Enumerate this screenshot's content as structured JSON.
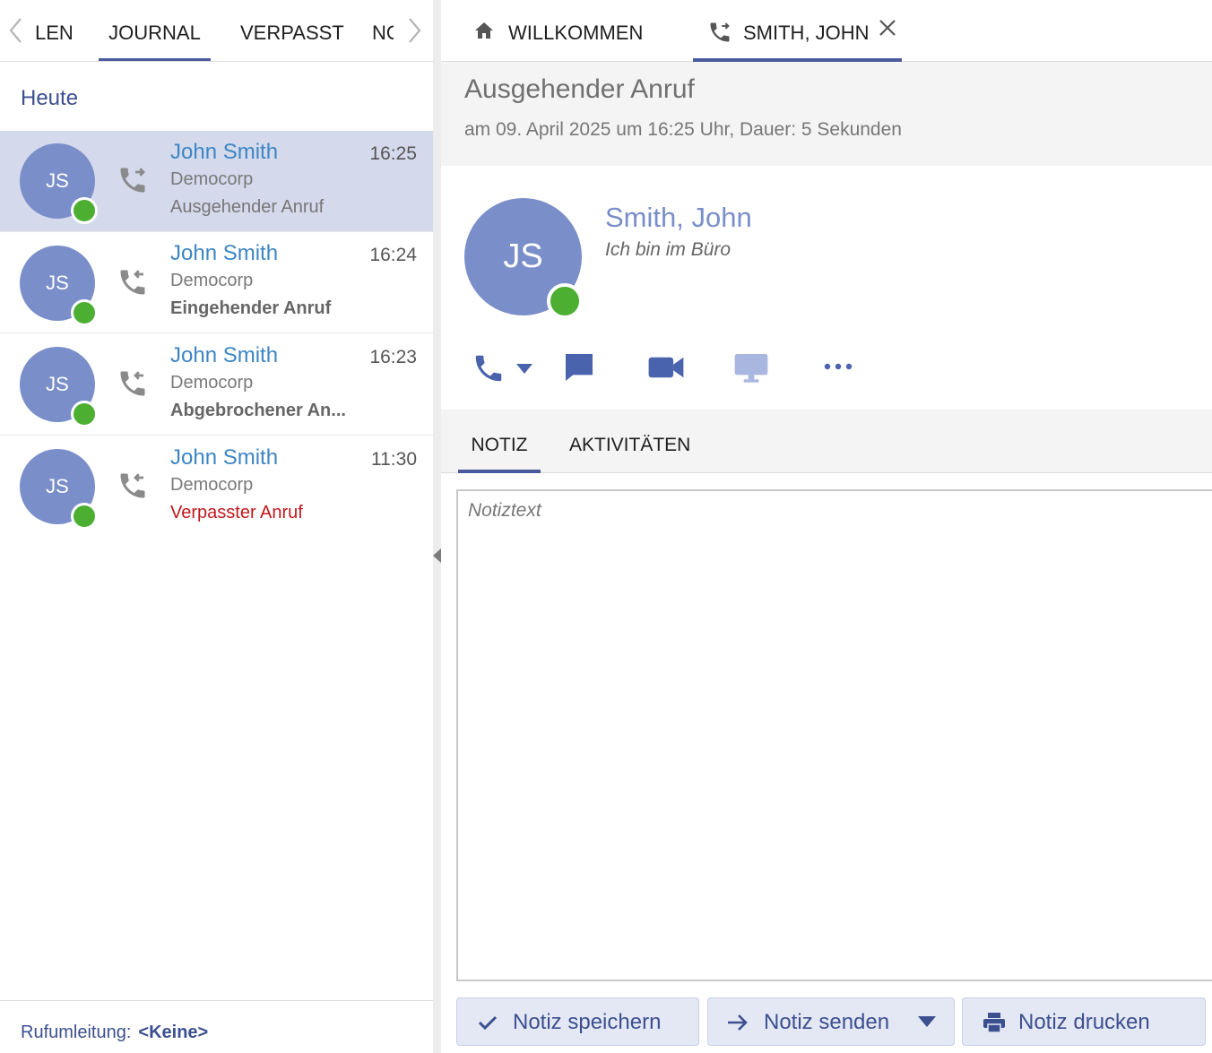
{
  "left_panel": {
    "tabs": [
      {
        "label": "LEN"
      },
      {
        "label": "JOURNAL"
      },
      {
        "label": "VERPASST"
      },
      {
        "label": "NOTIZEN"
      }
    ],
    "section_heading": "Heute",
    "calls": [
      {
        "initials": "JS",
        "name": "John Smith",
        "time": "16:25",
        "company": "Democorp",
        "status": "Ausgehender Anruf",
        "direction": "outgoing",
        "selected": true
      },
      {
        "initials": "JS",
        "name": "John Smith",
        "time": "16:24",
        "company": "Democorp",
        "status": "Eingehender Anruf",
        "direction": "incoming"
      },
      {
        "initials": "JS",
        "name": "John Smith",
        "time": "16:23",
        "company": "Democorp",
        "status": "Abgebrochener An...",
        "direction": "incoming"
      },
      {
        "initials": "JS",
        "name": "John Smith",
        "time": "11:30",
        "company": "Democorp",
        "status": "Verpasster Anruf",
        "direction": "incoming"
      }
    ],
    "footer": {
      "label": "Rufumleitung:",
      "value": "<Keine>"
    }
  },
  "right_panel": {
    "tabs": [
      {
        "label": "WILLKOMMEN",
        "icon": "home-icon"
      },
      {
        "label": "SMITH, JOHN",
        "icon": "phone-outgoing-icon"
      }
    ],
    "call_title": "Ausgehender Anruf",
    "call_details": "am 09. April 2025 um 16:25 Uhr, Dauer: 5 Sekunden",
    "contact": {
      "initials": "JS",
      "name": "Smith, John",
      "status": "Ich bin im Büro"
    },
    "actions": [
      "phone-icon",
      "chat-icon",
      "video-icon",
      "screen-share-icon",
      "more-icon"
    ],
    "sub_tabs": [
      {
        "label": "NOTIZ"
      },
      {
        "label": "AKTIVITÄTEN"
      }
    ],
    "note": {
      "placeholder": "Notiztext",
      "value": ""
    },
    "buttons": {
      "save": "Notiz speichern",
      "send": "Notiz senden",
      "print": "Notiz drucken"
    }
  },
  "colors": {
    "accent": "#4a5a9c",
    "avatar": "#7a8ec9",
    "presence": "#4caf32",
    "name": "#3d86c4",
    "missed": "#c0191d",
    "selected_row": "#d4d9ec"
  }
}
